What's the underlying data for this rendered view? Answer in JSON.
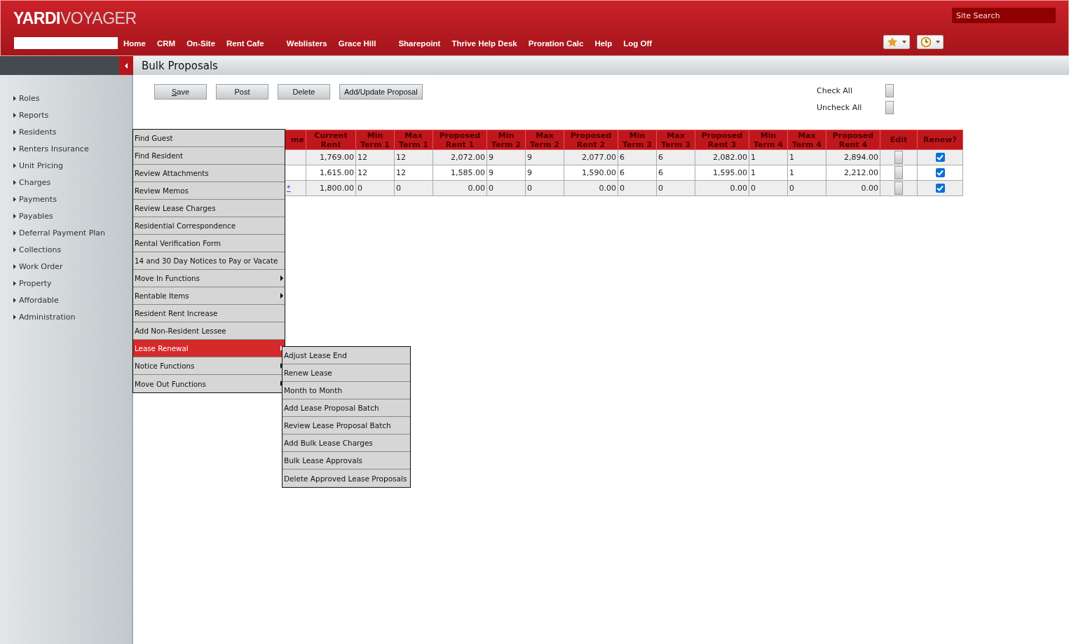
{
  "header": {
    "logo_bold": "YARDI",
    "logo_light": "VOYAGER",
    "site_search": {
      "placeholder": "Site Search"
    },
    "nav": [
      "Home",
      "CRM",
      "On-Site",
      "Rent Cafe",
      "Weblisters",
      "Grace Hill",
      "Sharepoint",
      "Thrive Help Desk",
      "Proration Calc",
      "Help",
      "Log Off"
    ]
  },
  "page_title": "Bulk Proposals",
  "sidebar": {
    "items": [
      "Roles",
      "Reports",
      "Residents",
      "Renters Insurance",
      "Unit Pricing",
      "Charges",
      "Payments",
      "Payables",
      "Deferral Payment Plan",
      "Collections",
      "Work Order",
      "Property",
      "Affordable",
      "Administration"
    ]
  },
  "buttons": [
    {
      "label": "Save",
      "underline_first": true
    },
    {
      "label": "Post",
      "underline_first": false
    },
    {
      "label": "Delete",
      "underline_first": false
    },
    {
      "label": "Add/Update Proposal",
      "underline_first": false
    }
  ],
  "check_all": {
    "label": "Check All"
  },
  "uncheck_all": {
    "label": "Uncheck All"
  },
  "table": {
    "columns": [
      "me",
      "Current Rent",
      "Min Term 1",
      "Max Term 1",
      "Proposed Rent 1",
      "Min Term 2",
      "Max Term 2",
      "Proposed Rent 2",
      "Min Term 3",
      "Max Term 3",
      "Proposed Rent 3",
      "Min Term 4",
      "Max Term 4",
      "Proposed Rent 4",
      "Edit",
      "Renew?"
    ],
    "rows": [
      {
        "values": [
          "1,769.00",
          "12",
          "12",
          "2,072.00",
          "9",
          "9",
          "2,077.00",
          "6",
          "6",
          "2,082.00",
          "1",
          "1",
          "2,894.00"
        ],
        "renew": true
      },
      {
        "values": [
          "1,615.00",
          "12",
          "12",
          "1,585.00",
          "9",
          "9",
          "1,590.00",
          "6",
          "6",
          "1,595.00",
          "1",
          "1",
          "2,212.00"
        ],
        "renew": true
      },
      {
        "link": "*",
        "values": [
          "1,800.00",
          "0",
          "0",
          "0.00",
          "0",
          "0",
          "0.00",
          "0",
          "0",
          "0.00",
          "0",
          "0",
          "0.00"
        ],
        "renew": true
      }
    ]
  },
  "menu": {
    "items": [
      {
        "label": "Find Guest",
        "submenu": false,
        "selected": false
      },
      {
        "label": "Find Resident",
        "submenu": false,
        "selected": false
      },
      {
        "label": "Review Attachments",
        "submenu": false,
        "selected": false
      },
      {
        "label": "Review Memos",
        "submenu": false,
        "selected": false
      },
      {
        "label": "Review Lease Charges",
        "submenu": false,
        "selected": false
      },
      {
        "label": "Residential Correspondence",
        "submenu": false,
        "selected": false
      },
      {
        "label": "Rental Verification Form",
        "submenu": false,
        "selected": false
      },
      {
        "label": "14 and 30 Day Notices to Pay or Vacate",
        "submenu": false,
        "selected": false
      },
      {
        "label": "Move In Functions",
        "submenu": true,
        "selected": false
      },
      {
        "label": "Rentable Items",
        "submenu": true,
        "selected": false
      },
      {
        "label": "Resident Rent Increase",
        "submenu": false,
        "selected": false
      },
      {
        "label": "Add Non-Resident Lessee",
        "submenu": false,
        "selected": false
      },
      {
        "label": "Lease Renewal",
        "submenu": true,
        "selected": true
      },
      {
        "label": "Notice Functions",
        "submenu": true,
        "selected": false
      },
      {
        "label": "Move Out Functions",
        "submenu": true,
        "selected": false
      }
    ],
    "submenu_items": [
      "Adjust Lease End",
      "Renew Lease",
      "Month to Month",
      "Add Lease Proposal Batch",
      "Review Lease Proposal Batch",
      "Add Bulk Lease Charges",
      "Bulk Lease Approvals",
      "Delete Approved Lease Proposals"
    ]
  }
}
